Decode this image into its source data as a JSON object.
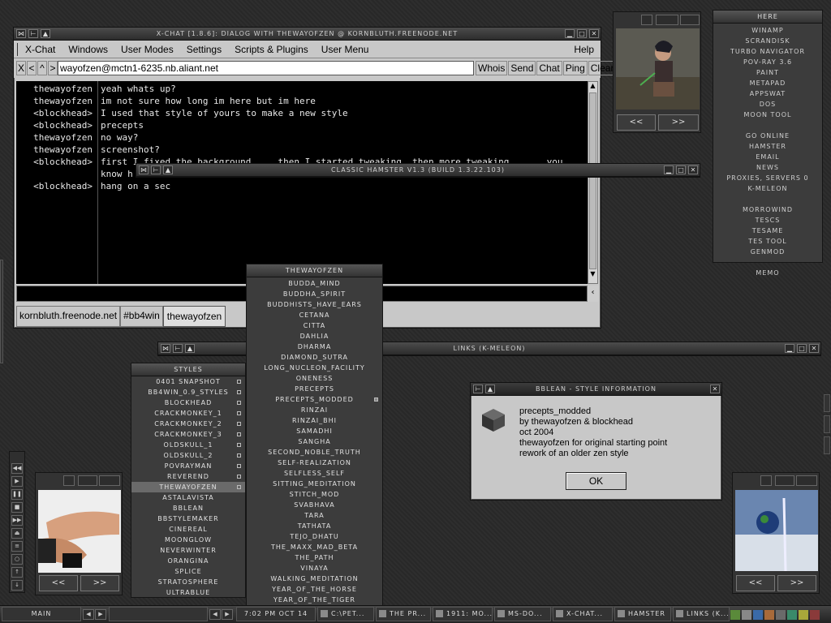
{
  "xchat": {
    "title": "X-Chat [1.8.6]: Dialog with thewayofzen @ kornbluth.freenode.net",
    "menu": [
      "X-Chat",
      "Windows",
      "User Modes",
      "Settings",
      "Scripts & Plugins",
      "User Menu"
    ],
    "help": "Help",
    "address": "wayofzen@mctn1-6235.nb.aliant.net",
    "nav": [
      "X",
      "<",
      "^",
      ">"
    ],
    "actions": [
      "Whois",
      "Send",
      "Chat",
      "Ping",
      "Clear"
    ],
    "messages": [
      {
        "nick": "thewayofzen",
        "text": "yeah whats up?"
      },
      {
        "nick": "thewayofzen",
        "text": "im not sure how long im here but im here"
      },
      {
        "nick": "<blockhead>",
        "text": "I used that style of yours to make a new style"
      },
      {
        "nick": "<blockhead>",
        "text": "precepts"
      },
      {
        "nick": "thewayofzen",
        "text": "no way?"
      },
      {
        "nick": "thewayofzen",
        "text": "screenshot?"
      },
      {
        "nick": "<blockhead>",
        "text": "first I fixed the background.... then I started tweaking, then more tweaking...... you"
      },
      {
        "nick": "",
        "text": "know h"
      },
      {
        "nick": "<blockhead>",
        "text": "hang on a sec"
      }
    ],
    "tabs": [
      "kornbluth.freenode.net",
      "#bb4win",
      "thewayofzen"
    ]
  },
  "hamster": {
    "title": "Classic Hamster v1.3 (build 1.3.22.103)"
  },
  "links": {
    "title": "Links (K-Meleon)"
  },
  "here": {
    "title": "Here",
    "items": [
      "Winamp",
      "Scrandisk",
      "Turbo Navigator",
      "POV-Ray 3.6",
      "Paint",
      "Metapad",
      "AppSwat",
      "DOS",
      "Moon Tool",
      "",
      "Go Online",
      "Hamster",
      "Email",
      "News",
      "Proxies, Servers 0",
      "K-Meleon",
      "",
      "Morrowind",
      "TESCS",
      "TESame",
      "TES Tool",
      "GenMod",
      "",
      "Memo"
    ]
  },
  "styles": {
    "title": "Styles",
    "items": [
      "0401 snapshot",
      "bb4win_0.9_styles",
      "blockhead",
      "crackmonkey_1",
      "crackmonkey_2",
      "crackmonkey_3",
      "oldskull_1",
      "oldskull_2",
      "povrayman",
      "reverend",
      "thewayofzen",
      "astalavista",
      "bblean",
      "bbstylemaker",
      "cinereal",
      "moonglow",
      "neverwinter",
      "orangina",
      "splice",
      "stratosphere",
      "ultrablue"
    ],
    "selected": 10
  },
  "zen": {
    "title": "thewayofzen",
    "items": [
      "budda_mind",
      "buddha_spirit",
      "buddhists_have_ears",
      "cetana",
      "citta",
      "dahlia",
      "dharma",
      "diamond_sutra",
      "long_nucleon_facility",
      "oneness",
      "precepts",
      "precepts_modded",
      "rinzai",
      "rinzai_bhi",
      "samadhi",
      "sangha",
      "second_noble_truth",
      "self-realization",
      "selfless_self",
      "sitting_meditation",
      "stitch_mod",
      "svabhava",
      "tara",
      "tathata",
      "tejo_dhatu",
      "the_maxx_mad_beta",
      "the_path",
      "vinaya",
      "walking_meditation",
      "year_of_the_horse",
      "year_of_the_tiger"
    ]
  },
  "dialog": {
    "title": "bbLean - Style Information",
    "lines": [
      "precepts_modded",
      "by thewayofzen & blockhead",
      "oct 2004",
      "thewayofzen for original starting point",
      "rework of an older zen style"
    ],
    "ok": "OK"
  },
  "gallery": {
    "prev": "<<",
    "next": ">>"
  },
  "taskbar": {
    "workspace": "Main",
    "clock": "7:02 PM Oct 14",
    "tasks": [
      "C:\\Pet...",
      "The Pr...",
      "1911: Mo...",
      "MS-DO...",
      "X-Chat...",
      "Hamster",
      "Links (K..."
    ]
  },
  "colors": {
    "accent": "#9a2fb0",
    "bg": "#2b2b2b"
  }
}
